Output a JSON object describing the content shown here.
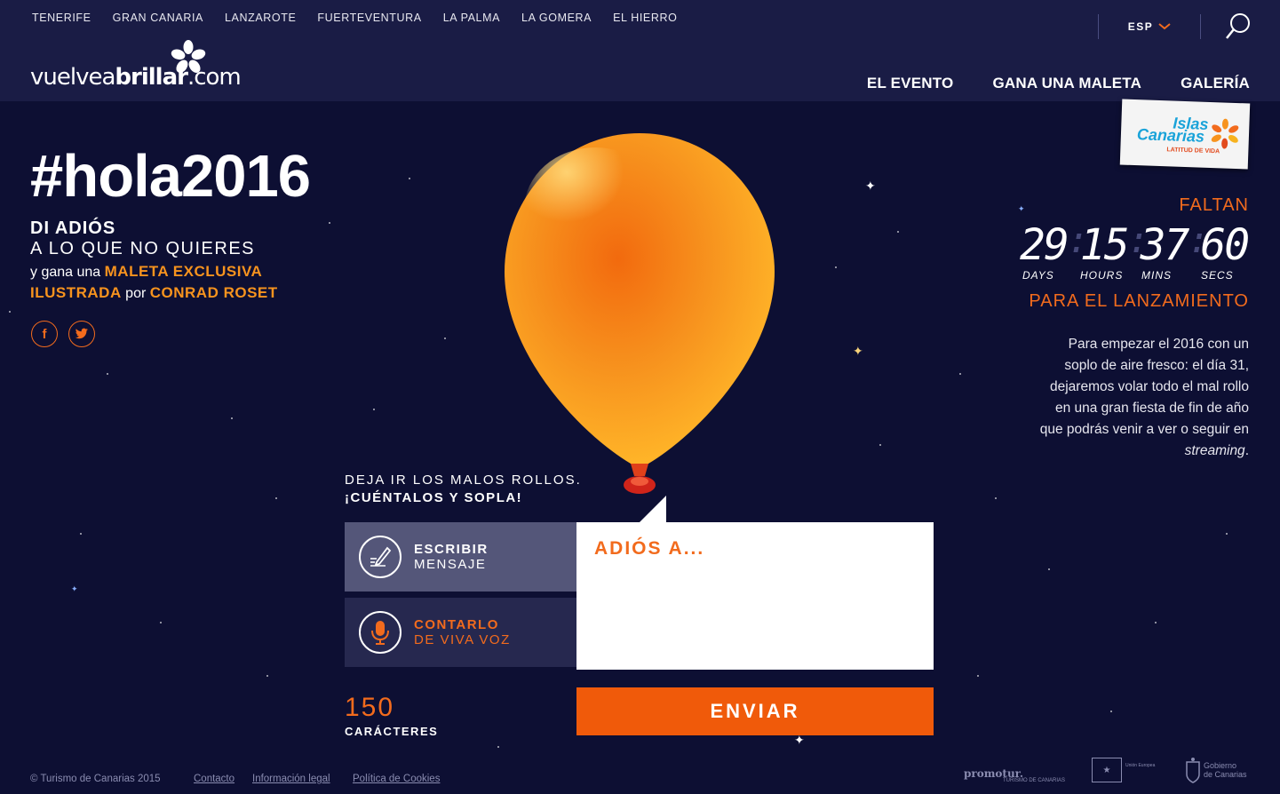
{
  "header": {
    "islands": [
      "TENERIFE",
      "GRAN CANARIA",
      "LANZAROTE",
      "FUERTEVENTURA",
      "LA PALMA",
      "LA GOMERA",
      "EL HIERRO"
    ],
    "logo": {
      "part1": "vuelvea",
      "part2": "brillar",
      "part3": ".com"
    },
    "language": "ESP",
    "nav": [
      "EL EVENTO",
      "GANA UNA MALETA",
      "GALERÍA"
    ]
  },
  "badge": {
    "line1": "Islas",
    "line2": "Canarias",
    "line3": "LATITUD DE VIDA"
  },
  "hero": {
    "title": "#hola2016",
    "line1": "DI ADIÓS",
    "line2": "A LO QUE NO QUIERES",
    "line3_pre": "y gana una ",
    "line3_hl": "MALETA EXCLUSIVA",
    "line4_hl1": "ILUSTRADA",
    "line4_mid": " por ",
    "line4_hl2": "CONRAD ROSET",
    "social": {
      "facebook": "f",
      "twitter": "t"
    }
  },
  "countdown": {
    "top_label": "FALTAN",
    "days": "29",
    "hours": "15",
    "mins": "37",
    "secs": "60",
    "unit_days": "DAYS",
    "unit_hours": "HOURS",
    "unit_mins": "MINS",
    "unit_secs": "SECS",
    "bottom_label": "PARA EL LANZAMIENTO"
  },
  "description": {
    "text": "Para empezar el 2016 con un soplo de aire fresco: el día 31, dejaremos volar todo el mal rollo en una gran fiesta de fin de año que podrás venir a ver o seguir en ",
    "em": "streaming",
    "end": "."
  },
  "form": {
    "prompt1": "DEJA IR LOS MALOS ROLLOS.",
    "prompt2": "¡CUÉNTALOS Y SOPLA!",
    "write_l1": "ESCRIBIR",
    "write_l2": "MENSAJE",
    "voice_l1": "CONTARLO",
    "voice_l2": "DE VIVA VOZ",
    "placeholder": "ADIÓS A...",
    "count": "150",
    "count_label": "CARÁCTERES",
    "send": "ENVIAR"
  },
  "footer": {
    "copyright": "© Turismo de Canarias 2015",
    "links": [
      "Contacto",
      "Información legal",
      "Política de Cookies"
    ],
    "logos": {
      "promotur": "promotur.",
      "promotur_sub": "TURISMO DE CANARIAS",
      "eu": "Unión Europea",
      "gov1": "Gobierno",
      "gov2": "de Canarias"
    }
  },
  "colors": {
    "accent": "#f26b1d",
    "orange_highlight": "#f7931e",
    "background": "#0d0f33",
    "header": "#1a1c45",
    "send_button": "#f05a0a"
  }
}
